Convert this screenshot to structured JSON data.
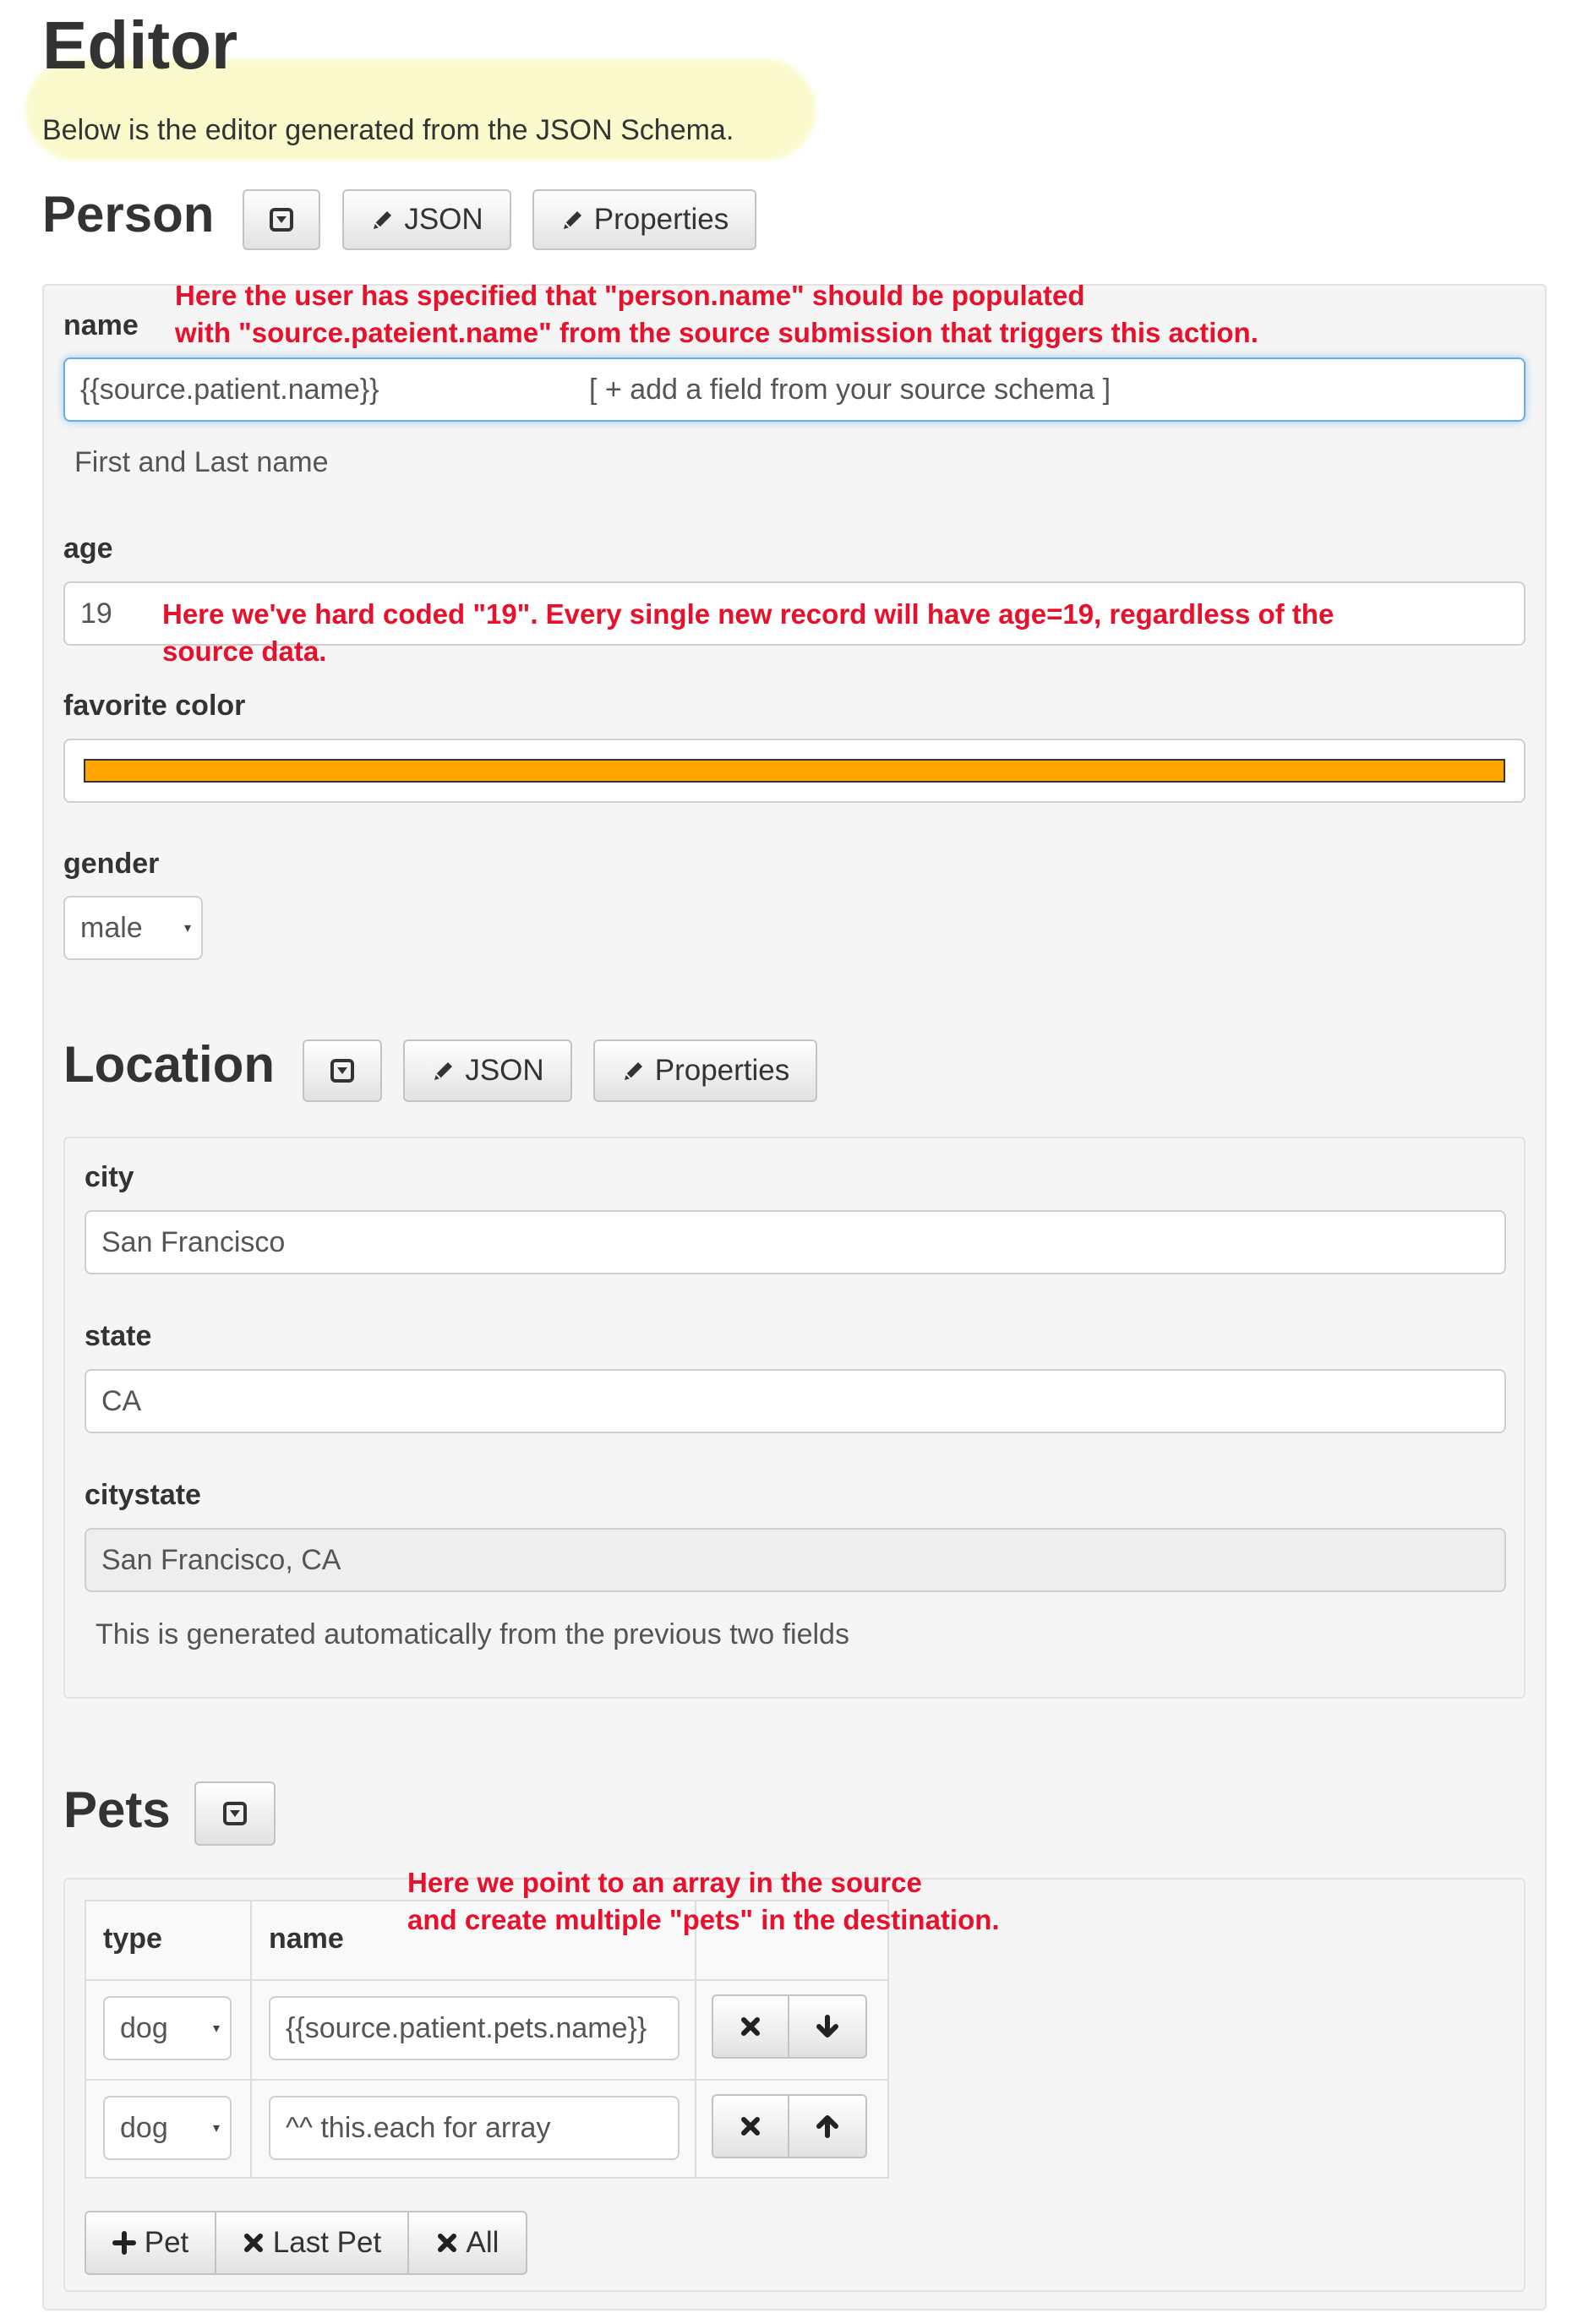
{
  "page": {
    "title": "Editor",
    "lead": "Below is the editor generated from the JSON Schema."
  },
  "person": {
    "title": "Person",
    "buttons": {
      "json": "JSON",
      "properties": "Properties"
    },
    "name": {
      "label": "name",
      "value": "{{source.patient.name}}",
      "add_field": "[ + add a field from your source schema ]",
      "help": "First and Last name"
    },
    "age": {
      "label": "age",
      "value": "19"
    },
    "favorite_color": {
      "label": "favorite color",
      "value_color": "#ffa500"
    },
    "gender": {
      "label": "gender",
      "value": "male"
    }
  },
  "location": {
    "title": "Location",
    "buttons": {
      "json": "JSON",
      "properties": "Properties"
    },
    "city": {
      "label": "city",
      "value": "San Francisco"
    },
    "state": {
      "label": "state",
      "value": "CA"
    },
    "citystate": {
      "label": "citystate",
      "value": "San Francisco, CA",
      "help": "This is generated automatically from the previous two fields"
    }
  },
  "pets": {
    "title": "Pets",
    "columns": [
      "type",
      "name"
    ],
    "rows": [
      {
        "type": "dog",
        "name": "{{source.patient.pets.name}}"
      },
      {
        "type": "dog",
        "name": "^^ this.each for array"
      }
    ],
    "footer_buttons": {
      "add": "Pet",
      "remove_last": "Last Pet",
      "remove_all": "All"
    }
  },
  "annotations": {
    "name": [
      "Here the user has specified that \"person.name\" should be populated",
      "with \"source.pateient.name\" from the source submission that triggers this action."
    ],
    "age": [
      "Here we've hard coded \"19\". Every single new record will have age=19, regardless of the",
      "source data."
    ],
    "pets": [
      "Here we point to an array in the source",
      "and create multiple \"pets\" in the destination."
    ]
  },
  "colors": {
    "annotation": "#e8102a",
    "highlighter": "#eef064",
    "favorite_color_bar": "#ffa500"
  },
  "icons": [
    "caret-square-down-icon",
    "pencil-icon",
    "times-icon",
    "arrow-down-icon",
    "arrow-up-icon",
    "plus-icon"
  ]
}
